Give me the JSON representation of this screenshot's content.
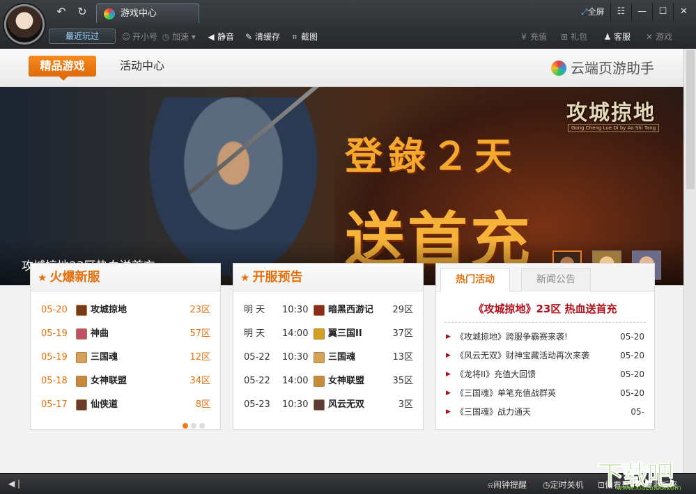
{
  "titlebar": {
    "tab_title": "游戏中心",
    "fullscreen": "全屏",
    "recent_label": "最近玩过",
    "tools": {
      "open_alt": "开小号",
      "speed": "加速",
      "mute": "静音",
      "clear_cache": "清缓存",
      "screenshot": "截图",
      "recharge": "充值",
      "gift": "礼包",
      "service": "客服",
      "games": "游戏"
    }
  },
  "header": {
    "tab_featured": "精品游戏",
    "tab_activity": "活动中心",
    "brand": "云端页游助手"
  },
  "banner": {
    "logo": "攻城掠地",
    "logo_sub": "Gong Cheng Lue Di by Ao Shi Tang",
    "slogan_line1": "登錄２天",
    "slogan_line2": "送首充",
    "caption": "攻城掠地23区热血送首充"
  },
  "hot_servers": {
    "title": "火爆新服",
    "rows": [
      {
        "date": "05-20",
        "name": "攻城掠地",
        "zone": "23区",
        "color": "#7a3a1a"
      },
      {
        "date": "05-19",
        "name": "神曲",
        "zone": "57区",
        "color": "#c0506a"
      },
      {
        "date": "05-19",
        "name": "三国魂",
        "zone": "12区",
        "color": "#d7a25a"
      },
      {
        "date": "05-18",
        "name": "女神联盟",
        "zone": "34区",
        "color": "#c78a3a"
      },
      {
        "date": "05-17",
        "name": "仙侠道",
        "zone": "8区",
        "color": "#6a3a2a"
      }
    ]
  },
  "upcoming": {
    "title": "开服预告",
    "rows": [
      {
        "date": "明 天",
        "time": "10:30",
        "name": "暗黑西游记",
        "zone": "29区",
        "color": "#8a2a1a"
      },
      {
        "date": "明 天",
        "time": "14:00",
        "name": "翼三国II",
        "zone": "37区",
        "color": "#d4a020"
      },
      {
        "date": "05-22",
        "time": "10:30",
        "name": "三国魂",
        "zone": "13区",
        "color": "#d7a25a"
      },
      {
        "date": "05-22",
        "time": "14:00",
        "name": "女神联盟",
        "zone": "35区",
        "color": "#c78a3a"
      },
      {
        "date": "05-23",
        "time": "10:30",
        "name": "风云无双",
        "zone": "3区",
        "color": "#5a3a3a"
      }
    ]
  },
  "activities": {
    "tab_hot": "热门活动",
    "tab_news": "新闻公告",
    "headline": "《攻城掠地》23区  热血送首充",
    "items": [
      {
        "text": "《攻城掠地》跨服争霸赛来袭!",
        "date": "05-20"
      },
      {
        "text": "《风云无双》财神宝藏活动再次来袭",
        "date": "05-20"
      },
      {
        "text": "《龙将II》充值大回馈",
        "date": "05-20"
      },
      {
        "text": "《三国魂》单笔充值战群英",
        "date": "05-20"
      },
      {
        "text": "《三国魂》战力通天",
        "date": "05-"
      }
    ]
  },
  "statusbar": {
    "alarm": "闹钟提醒",
    "shutdown": "定时关机",
    "peek": "偷看玩",
    "boss": "老板来"
  },
  "watermark": {
    "big": "下载吧",
    "small": "www.xiazaiba.com"
  },
  "colors": {
    "accent": "#e8700c",
    "headline_red": "#b10e1a",
    "titlebar": "#2b2d30"
  }
}
